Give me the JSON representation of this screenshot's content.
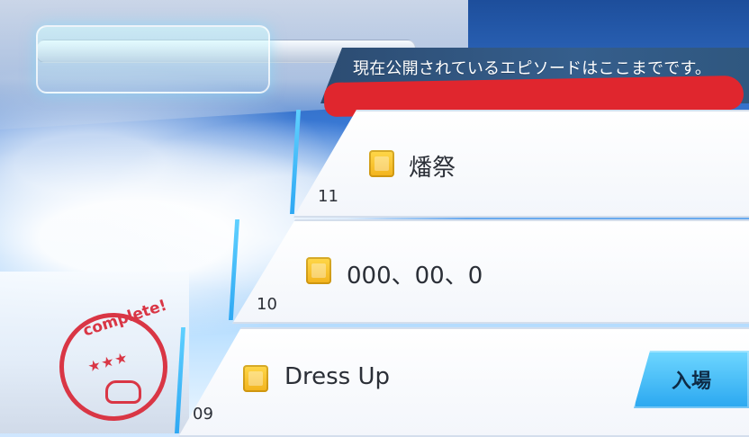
{
  "notice": {
    "text": "現在公開されているエピソードはここまでです。"
  },
  "episodes": [
    {
      "number": "11",
      "title": "燔祭",
      "icon": "book-icon"
    },
    {
      "number": "10",
      "title": "000、00、0",
      "icon": "book-icon"
    },
    {
      "number": "09",
      "title": "Dress Up",
      "icon": "book-icon",
      "action_label": "入場"
    }
  ],
  "stamp": {
    "text": "complete!",
    "color": "#d93645"
  },
  "colors": {
    "notice_bg": "#2c4c72",
    "accent_blue": "#2aa7f0",
    "redaction_red": "#e0262e"
  }
}
